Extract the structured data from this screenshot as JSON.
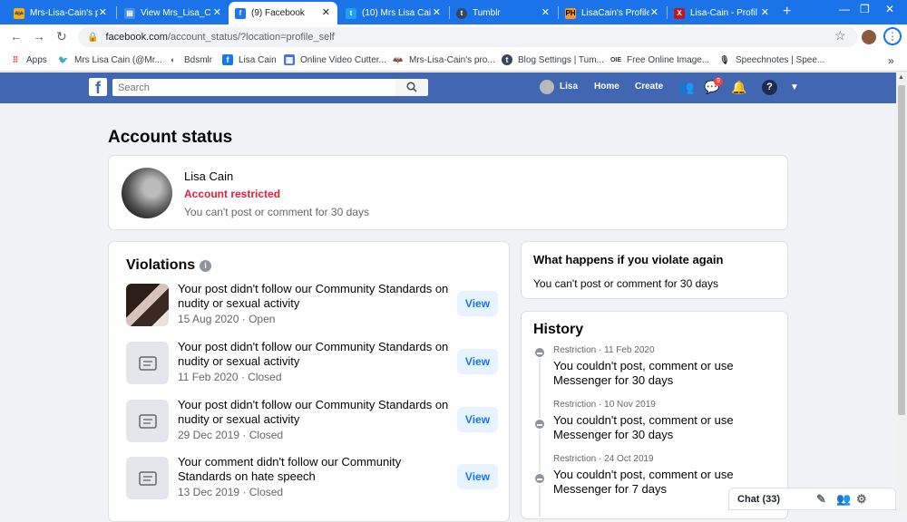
{
  "browser": {
    "tabs": [
      {
        "title": "Mrs-Lisa-Cain's p",
        "icon": "bat-icon",
        "color": "#f4b400"
      },
      {
        "title": "View Mrs_Lisa_C",
        "icon": "page-icon",
        "color": "#4a90d9"
      },
      {
        "title": "(9) Facebook",
        "icon": "facebook-icon",
        "color": "#1877f2"
      },
      {
        "title": "(10) Mrs Lisa Cai",
        "icon": "twitter-icon",
        "color": "#1da1f2"
      },
      {
        "title": "Tumblr",
        "icon": "tumblr-icon",
        "color": "#36465d"
      },
      {
        "title": "LisaCain's Profile",
        "icon": "ph-icon",
        "color": "#f7971d"
      },
      {
        "title": "Lisa-Cain - Profil",
        "icon": "x-icon",
        "color": "#c4161c"
      }
    ],
    "url_host": "facebook.com",
    "url_path": "/account_status/?location=profile_self",
    "bookmarks": [
      {
        "label": "Apps",
        "icon": "apps-grid-icon"
      },
      {
        "label": "Mrs Lisa Cain (@Mr...",
        "icon": "twitter-icon"
      },
      {
        "label": "Bdsmlr",
        "icon": "bdsmlr-icon"
      },
      {
        "label": "Lisa Cain",
        "icon": "facebook-icon"
      },
      {
        "label": "Online Video Cutter...",
        "icon": "video-cutter-icon"
      },
      {
        "label": "Mrs-Lisa-Cain's pro...",
        "icon": "bat-icon"
      },
      {
        "label": "Blog Settings | Tum...",
        "icon": "tumblr-icon"
      },
      {
        "label": "Free Online Image...",
        "icon": "oie-icon"
      },
      {
        "label": "Speechnotes | Spee...",
        "icon": "microphone-icon"
      }
    ],
    "bookmarks_more": "»"
  },
  "facebook": {
    "search_placeholder": "Search",
    "user_name": "Lisa",
    "nav_home": "Home",
    "nav_create": "Create",
    "messenger_badge": "9",
    "brand_color": "#4267b2"
  },
  "page": {
    "title": "Account status",
    "profile": {
      "name": "Lisa Cain",
      "status": "Account restricted",
      "description": "You can't post or comment for 30 days"
    },
    "violations": {
      "title": "Violations",
      "view_label": "View",
      "items": [
        {
          "text": "Your post didn't follow our Community Standards on nudity or sexual activity",
          "date": "15 Aug 2020",
          "state": "Open",
          "thumb": "photo"
        },
        {
          "text": "Your post didn't follow our Community Standards on nudity or sexual activity",
          "date": "11 Feb 2020",
          "state": "Closed",
          "thumb": "message-icon"
        },
        {
          "text": "Your post didn't follow our Community Standards on nudity or sexual activity",
          "date": "29 Dec 2019",
          "state": "Closed",
          "thumb": "message-icon"
        },
        {
          "text": "Your comment didn't follow our Community Standards on hate speech",
          "date": "13 Dec 2019",
          "state": "Closed",
          "thumb": "message-icon"
        }
      ]
    },
    "what_happens": {
      "title": "What happens if you violate again",
      "description": "You can't post or comment for 30 days"
    },
    "history": {
      "title": "History",
      "items": [
        {
          "label": "Restriction",
          "date": "11 Feb 2020",
          "text": "You couldn't post, comment or use Messenger for 30 days"
        },
        {
          "label": "Restriction",
          "date": "10 Nov 2019",
          "text": "You couldn't post, comment or use Messenger for 30 days"
        },
        {
          "label": "Restriction",
          "date": "24 Oct 2019",
          "text": "You couldn't post, comment or use Messenger for 7 days"
        }
      ]
    },
    "chat_label": "Chat (33)"
  }
}
